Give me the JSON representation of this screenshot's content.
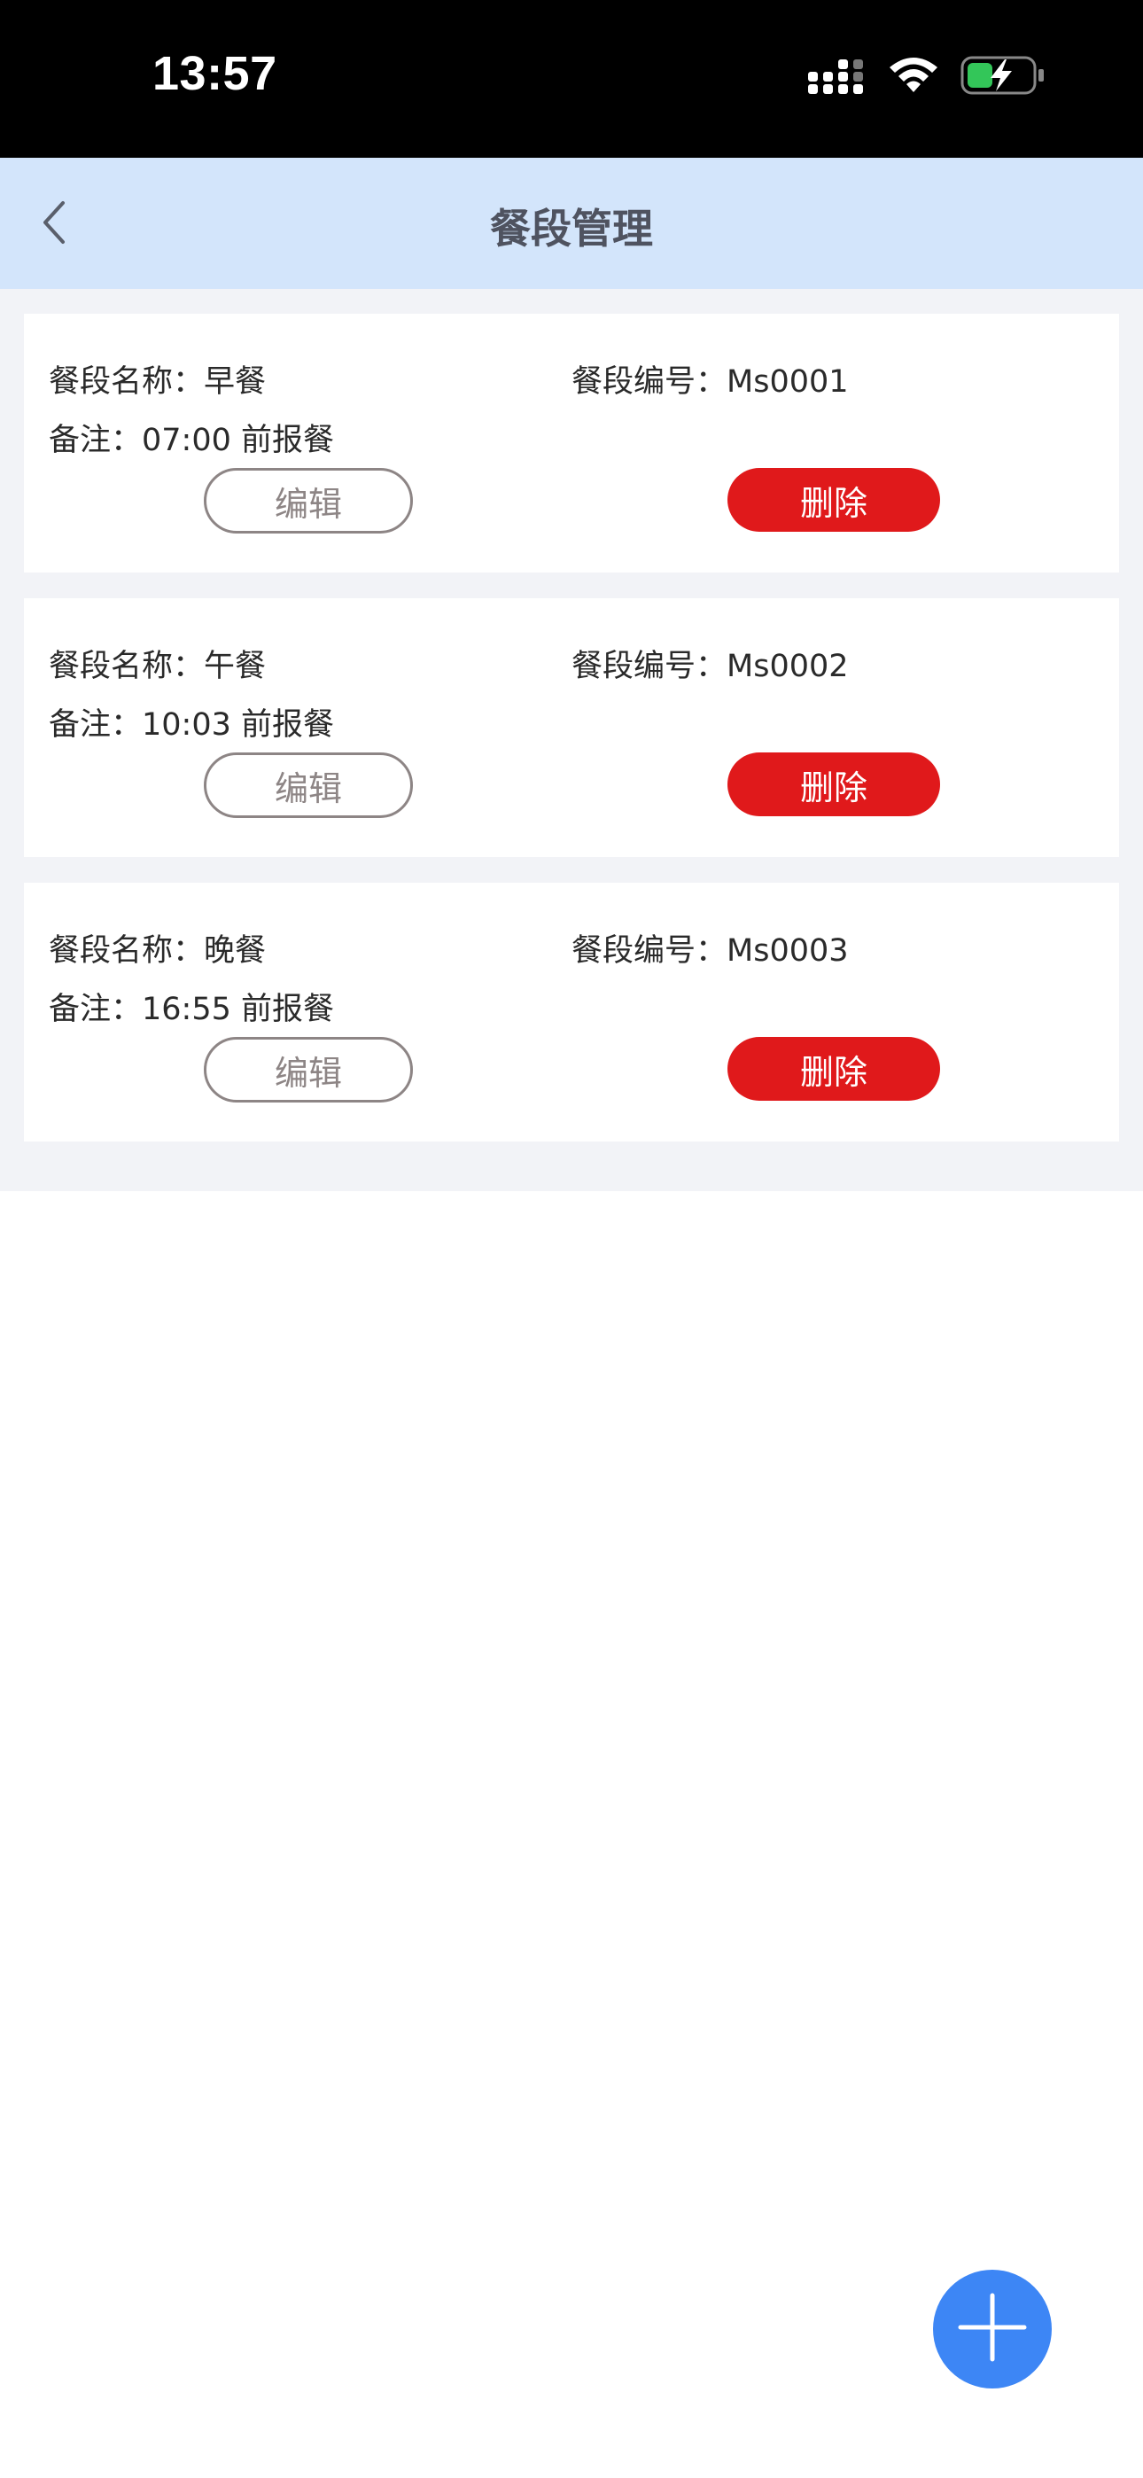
{
  "status_bar": {
    "time": "13:57",
    "icons": [
      "cellular-signal-icon",
      "wifi-icon",
      "battery-charging-icon"
    ]
  },
  "nav": {
    "back_icon": "chevron-left-icon",
    "title": "餐段管理"
  },
  "meal_periods": [
    {
      "name_label": "餐段名称：",
      "name": "早餐",
      "code_label": "餐段编号：",
      "code": "Ms0001",
      "note_label": "备注：",
      "note": "07:00 前报餐",
      "edit_label": "编辑",
      "delete_label": "删除"
    },
    {
      "name_label": "餐段名称：",
      "name": "午餐",
      "code_label": "餐段编号：",
      "code": "Ms0002",
      "note_label": "备注：",
      "note": "10:03 前报餐",
      "edit_label": "编辑",
      "delete_label": "删除"
    },
    {
      "name_label": "餐段名称：",
      "name": "晚餐",
      "code_label": "餐段编号：",
      "code": "Ms0003",
      "note_label": "备注：",
      "note": "16:55 前报餐",
      "edit_label": "编辑",
      "delete_label": "删除"
    }
  ],
  "fab": {
    "icon": "plus-icon"
  },
  "colors": {
    "nav_background": "#d3e5fb",
    "list_background": "#f2f3f7",
    "delete_red": "#e0191b",
    "edit_border": "#8d8585",
    "fab_blue": "#3d86f5",
    "title_text": "#4f5360"
  }
}
